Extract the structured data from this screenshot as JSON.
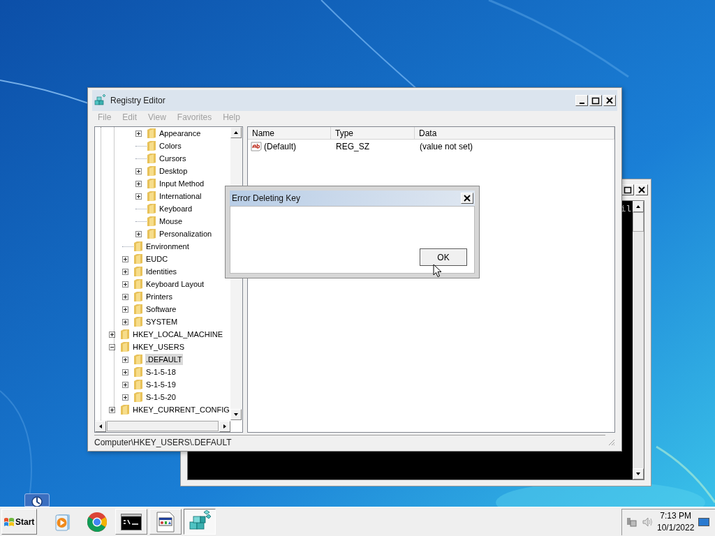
{
  "console_window": {
    "text": "il"
  },
  "registry_editor": {
    "title": "Registry Editor",
    "menu": [
      {
        "label": "File",
        "disabled": true
      },
      {
        "label": "Edit",
        "disabled": true
      },
      {
        "label": "View",
        "disabled": true
      },
      {
        "label": "Favorites",
        "disabled": true
      },
      {
        "label": "Help",
        "disabled": true
      }
    ],
    "tree": [
      {
        "children": [
          {
            "children": [
              {
                "label": "Appearance",
                "expanded": false,
                "selected": false
              },
              {
                "label": "Colors",
                "selected": false
              },
              {
                "label": "Cursors",
                "selected": false
              },
              {
                "label": "Desktop",
                "expanded": false,
                "selected": false
              },
              {
                "label": "Input Method",
                "expanded": false,
                "selected": false
              },
              {
                "label": "International",
                "expanded": false,
                "selected": false
              },
              {
                "label": "Keyboard",
                "selected": false
              },
              {
                "label": "Mouse",
                "selected": false
              },
              {
                "label": "Personalization",
                "expanded": false,
                "selected": false
              }
            ]
          },
          {
            "label": "Environment",
            "selected": false
          },
          {
            "label": "EUDC",
            "expanded": false,
            "selected": false
          },
          {
            "label": "Identities",
            "expanded": false,
            "selected": false
          },
          {
            "label": "Keyboard Layout",
            "expanded": false,
            "selected": false
          },
          {
            "label": "Printers",
            "expanded": false,
            "selected": false
          },
          {
            "label": "Software",
            "expanded": false,
            "selected": false
          },
          {
            "label": "SYSTEM",
            "expanded": false,
            "selected": false
          }
        ]
      },
      {
        "label": "HKEY_LOCAL_MACHINE",
        "expanded": false,
        "selected": false
      },
      {
        "label": "HKEY_USERS",
        "expanded": true,
        "selected": false,
        "children": [
          {
            "label": ".DEFAULT",
            "expanded": false,
            "selected": true
          },
          {
            "label": "S-1-5-18",
            "expanded": false,
            "selected": false
          },
          {
            "label": "S-1-5-19",
            "expanded": false,
            "selected": false
          },
          {
            "label": "S-1-5-20",
            "expanded": false,
            "selected": false
          }
        ]
      },
      {
        "label": "HKEY_CURRENT_CONFIG",
        "expanded": false,
        "selected": false
      }
    ],
    "columns": [
      "Name",
      "Type",
      "Data"
    ],
    "rows": [
      {
        "name": "(Default)",
        "type": "REG_SZ",
        "data": "(value not set)"
      }
    ],
    "status_bar": "Computer\\HKEY_USERS\\.DEFAULT"
  },
  "dialog": {
    "title": "Error Deleting Key",
    "button": "OK"
  },
  "taskbar": {
    "start": "Start",
    "apps": [
      {
        "kind": "media",
        "selected": false
      },
      {
        "kind": "browser",
        "selected": false
      },
      {
        "kind": "console",
        "selected": false
      },
      {
        "kind": "window",
        "selected": false
      },
      {
        "kind": "registry",
        "selected": true
      }
    ],
    "clock": {
      "time": "7:13 PM",
      "date": "10/1/2022"
    }
  }
}
